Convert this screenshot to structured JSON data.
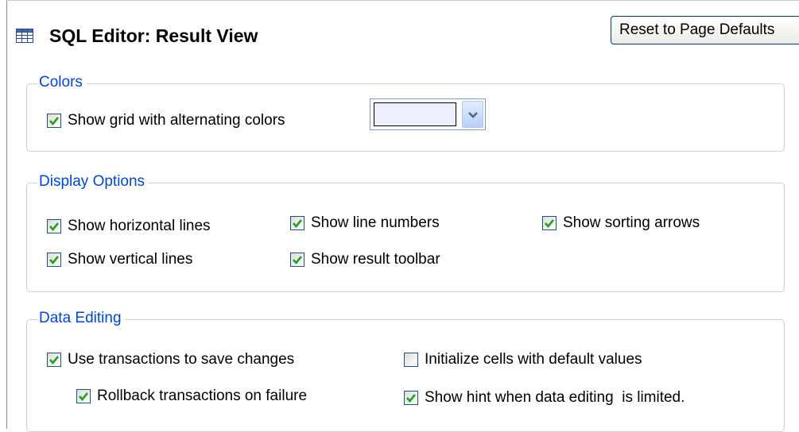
{
  "header": {
    "title": "SQL Editor: Result View",
    "title_icon": "table-grid-icon",
    "reset_button": "Reset to Page Defaults"
  },
  "colors_group": {
    "legend": "Colors",
    "alternating_colors": {
      "label": "Show grid with alternating colors",
      "checked": true
    },
    "color_picker": {
      "selected_color": "#ebf0ff",
      "icon": "chevron-down-icon"
    }
  },
  "display_group": {
    "legend": "Display Options",
    "options": [
      {
        "label": "Show horizontal lines",
        "checked": true
      },
      {
        "label": "Show line numbers",
        "checked": true
      },
      {
        "label": "Show sorting arrows",
        "checked": true
      },
      {
        "label": "Show vertical lines",
        "checked": true
      },
      {
        "label": "Show result toolbar",
        "checked": true
      }
    ]
  },
  "editing_group": {
    "legend": "Data Editing",
    "options": [
      {
        "label": "Use transactions to save changes",
        "checked": true
      },
      {
        "label": "Initialize cells with default values",
        "checked": false
      },
      {
        "label": "Rollback transactions on failure",
        "checked": true
      },
      {
        "label": "Show hint when data editing  is limited.",
        "checked": true
      }
    ]
  },
  "theme": {
    "legend_color": "#0046d5",
    "checkbox_border": "#1c5180",
    "tick_color": "#21a121"
  }
}
